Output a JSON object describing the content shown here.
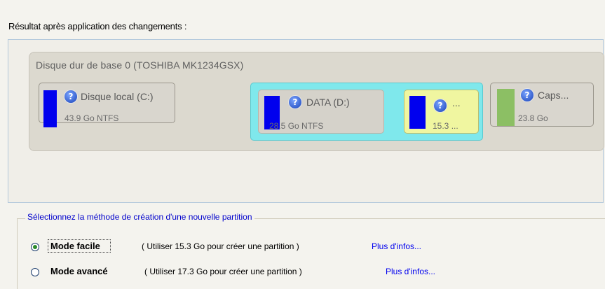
{
  "heading": "Résultat après application des changements :",
  "disk": {
    "title": "Disque dur de base 0 (TOSHIBA MK1234GSX)",
    "partitions": [
      {
        "label": "Disque local (C:)",
        "size": "43.9 Go NTFS",
        "color": "#0000ee"
      },
      {
        "label": "DATA (D:)",
        "size": "28.5 Go NTFS",
        "color": "#0000ee"
      },
      {
        "label": "...",
        "size": "15.3 ...",
        "color": "#0000ee"
      },
      {
        "label": "Caps...",
        "size": "23.8 Go",
        "color": "#8cbf64"
      }
    ]
  },
  "method": {
    "legend": "Sélectionnez la méthode de création d'une nouvelle partition",
    "options": [
      {
        "label": "Mode facile",
        "hint": "( Utiliser 15.3 Go pour créer une partition )",
        "more": "Plus d'infos...",
        "selected": true
      },
      {
        "label": "Mode avancé",
        "hint": "( Utiliser 17.3 Go pour créer une partition )",
        "more": "Plus d'infos...",
        "selected": false
      }
    ]
  },
  "icons": {
    "help": "help-question-icon"
  },
  "colors": {
    "accent": "#0000ee",
    "highlight": "#7fe8ec",
    "selection": "#f0f6a0"
  }
}
